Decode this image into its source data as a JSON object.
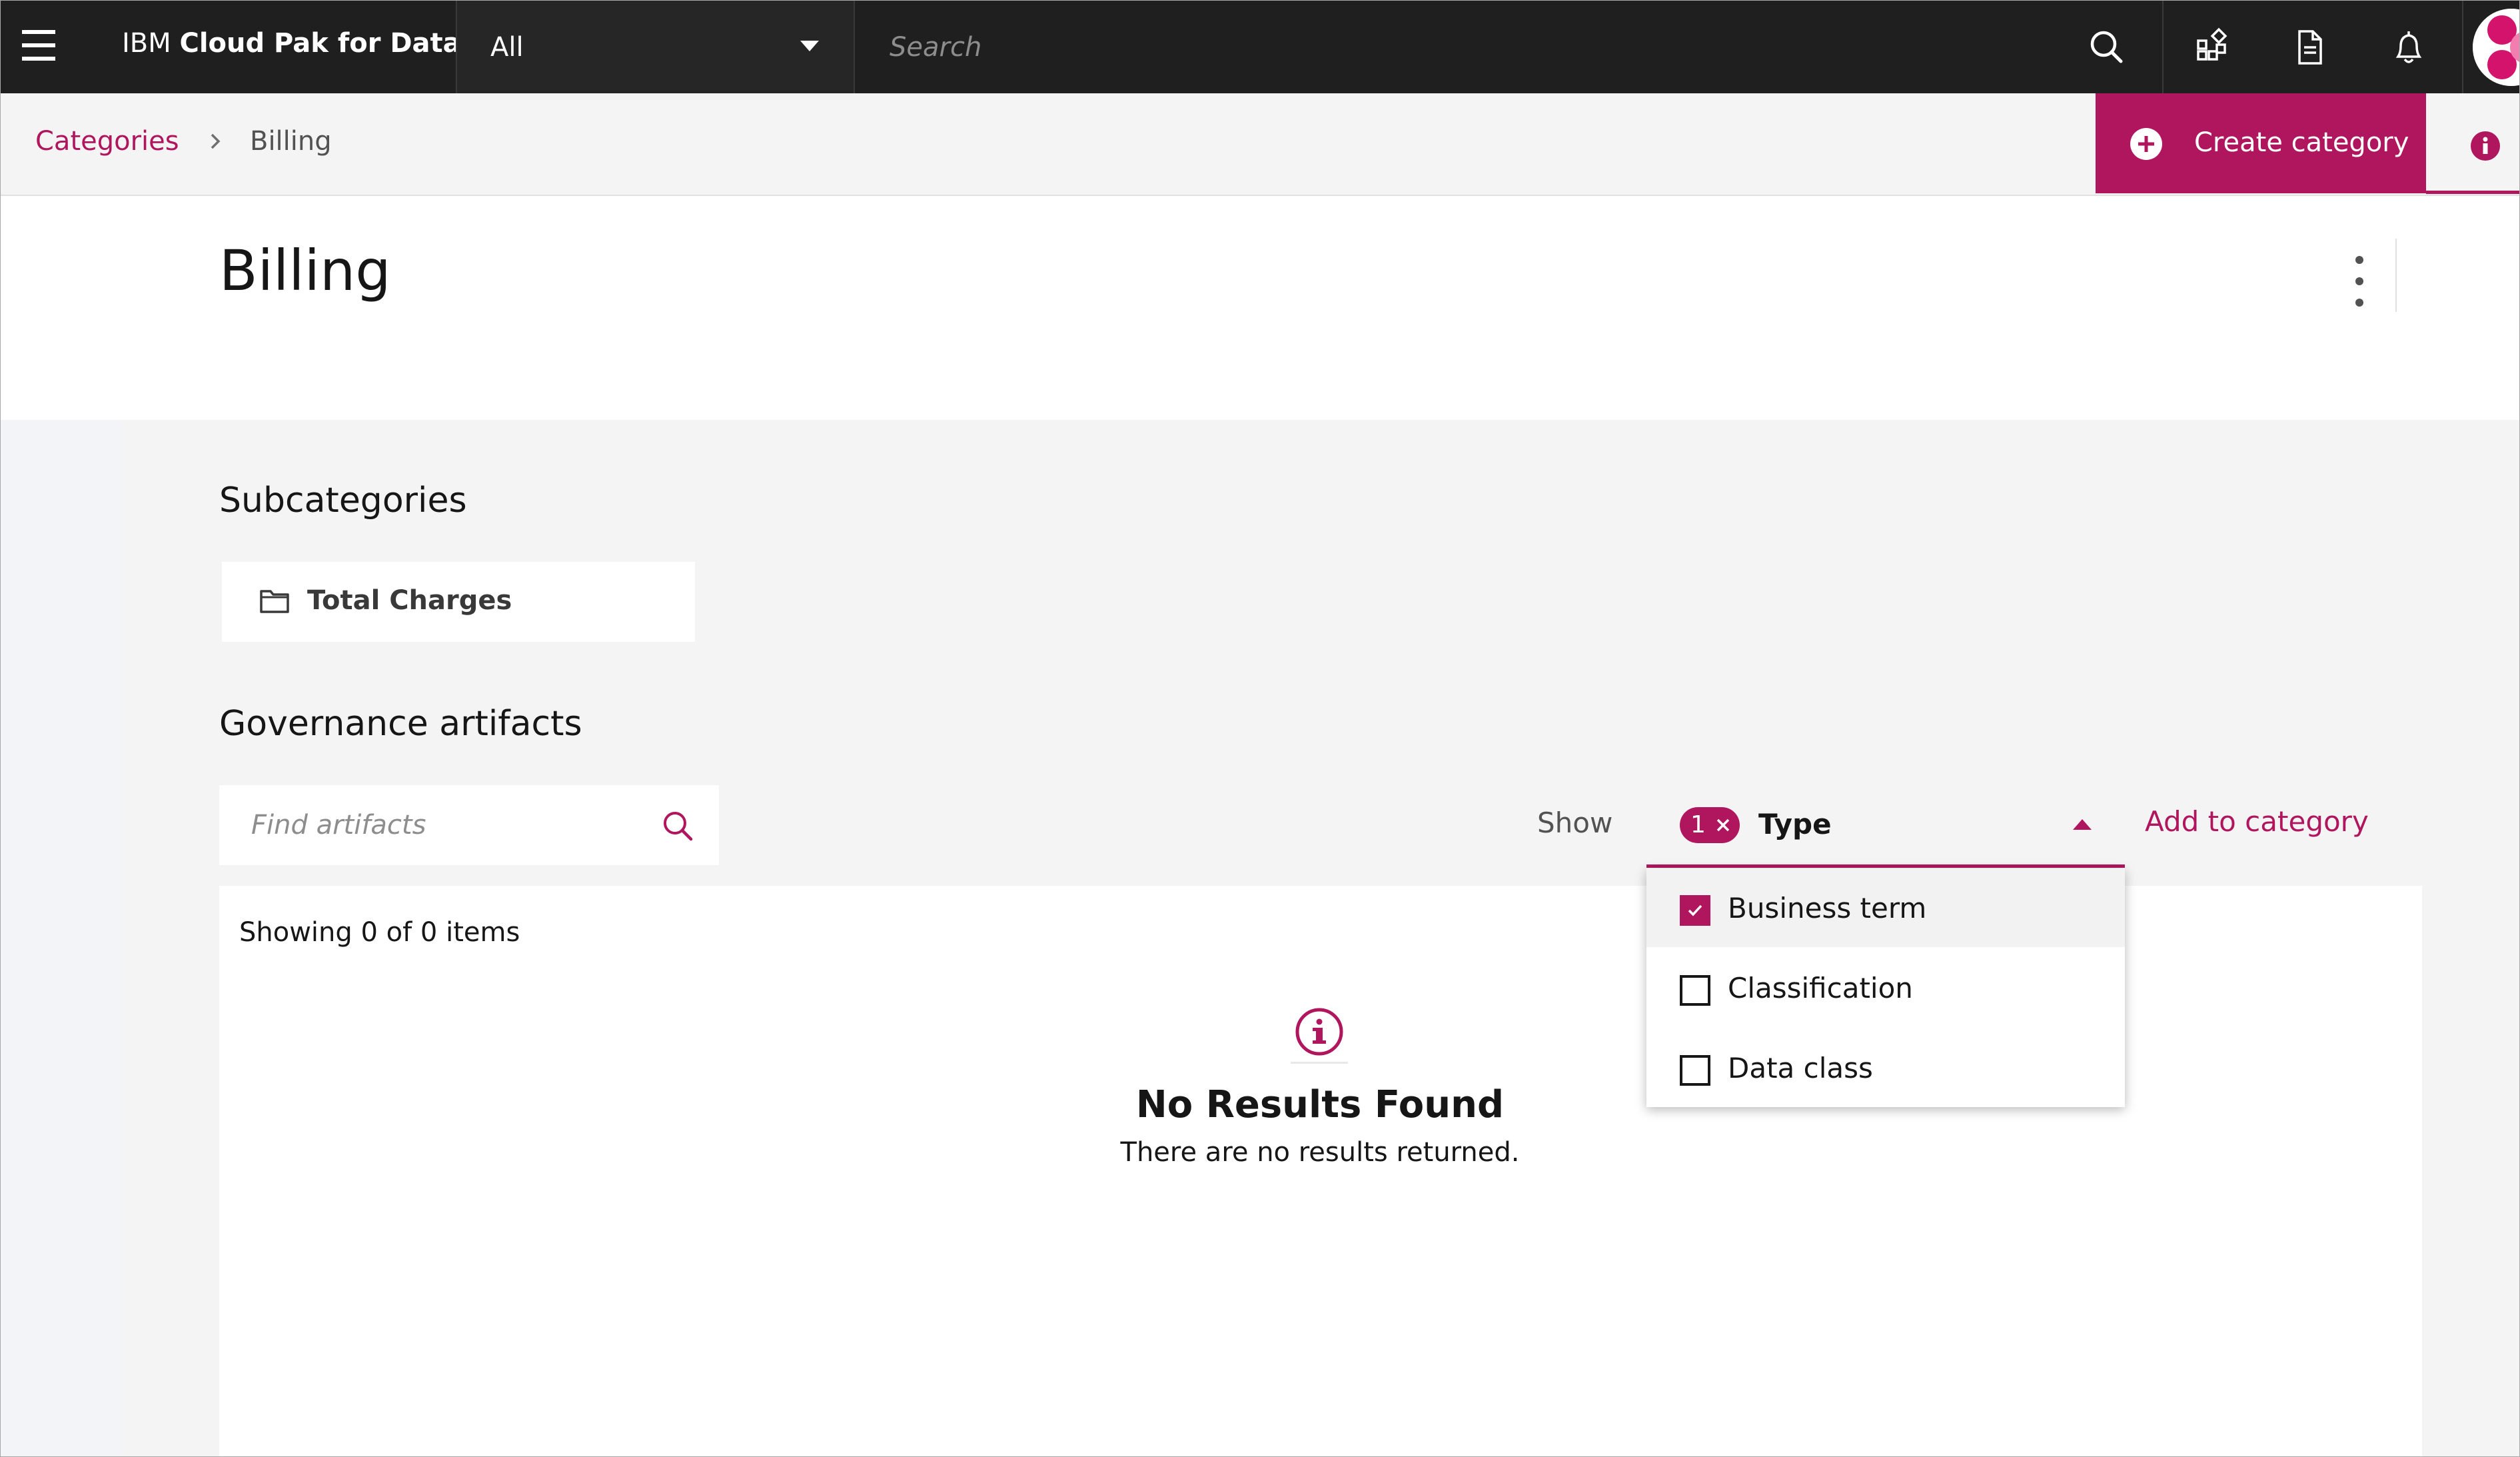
{
  "topbar": {
    "brand_prefix": "IBM ",
    "brand_name": "Cloud Pak for Data",
    "scope_value": "All",
    "search_placeholder": "Search",
    "icons": [
      "menu-icon",
      "search-icon",
      "catalog-grid-icon",
      "document-icon",
      "notification-icon",
      "user-avatar"
    ]
  },
  "breadcrumb": {
    "parent": "Categories",
    "current": "Billing"
  },
  "actions": {
    "create_category": "Create category"
  },
  "page": {
    "title": "Billing"
  },
  "subcategories": {
    "heading": "Subcategories",
    "items": [
      {
        "label": "Total Charges",
        "icon": "folder-icon"
      }
    ]
  },
  "governance": {
    "heading": "Governance artifacts",
    "find_placeholder": "Find artifacts",
    "show_label": "Show",
    "filter": {
      "label": "Type",
      "selected_count": "1",
      "options": [
        {
          "label": "Business term",
          "checked": true
        },
        {
          "label": "Classification",
          "checked": false
        },
        {
          "label": "Data class",
          "checked": false
        }
      ]
    },
    "add_to_category": "Add to category",
    "showing_text": "Showing 0 of 0 items",
    "empty_title": "No Results Found",
    "empty_subtitle": "There are no results returned."
  },
  "colors": {
    "accent": "#b0165e",
    "topbar_bg": "#1f1f1f",
    "content_bg": "#f4f4f4"
  }
}
